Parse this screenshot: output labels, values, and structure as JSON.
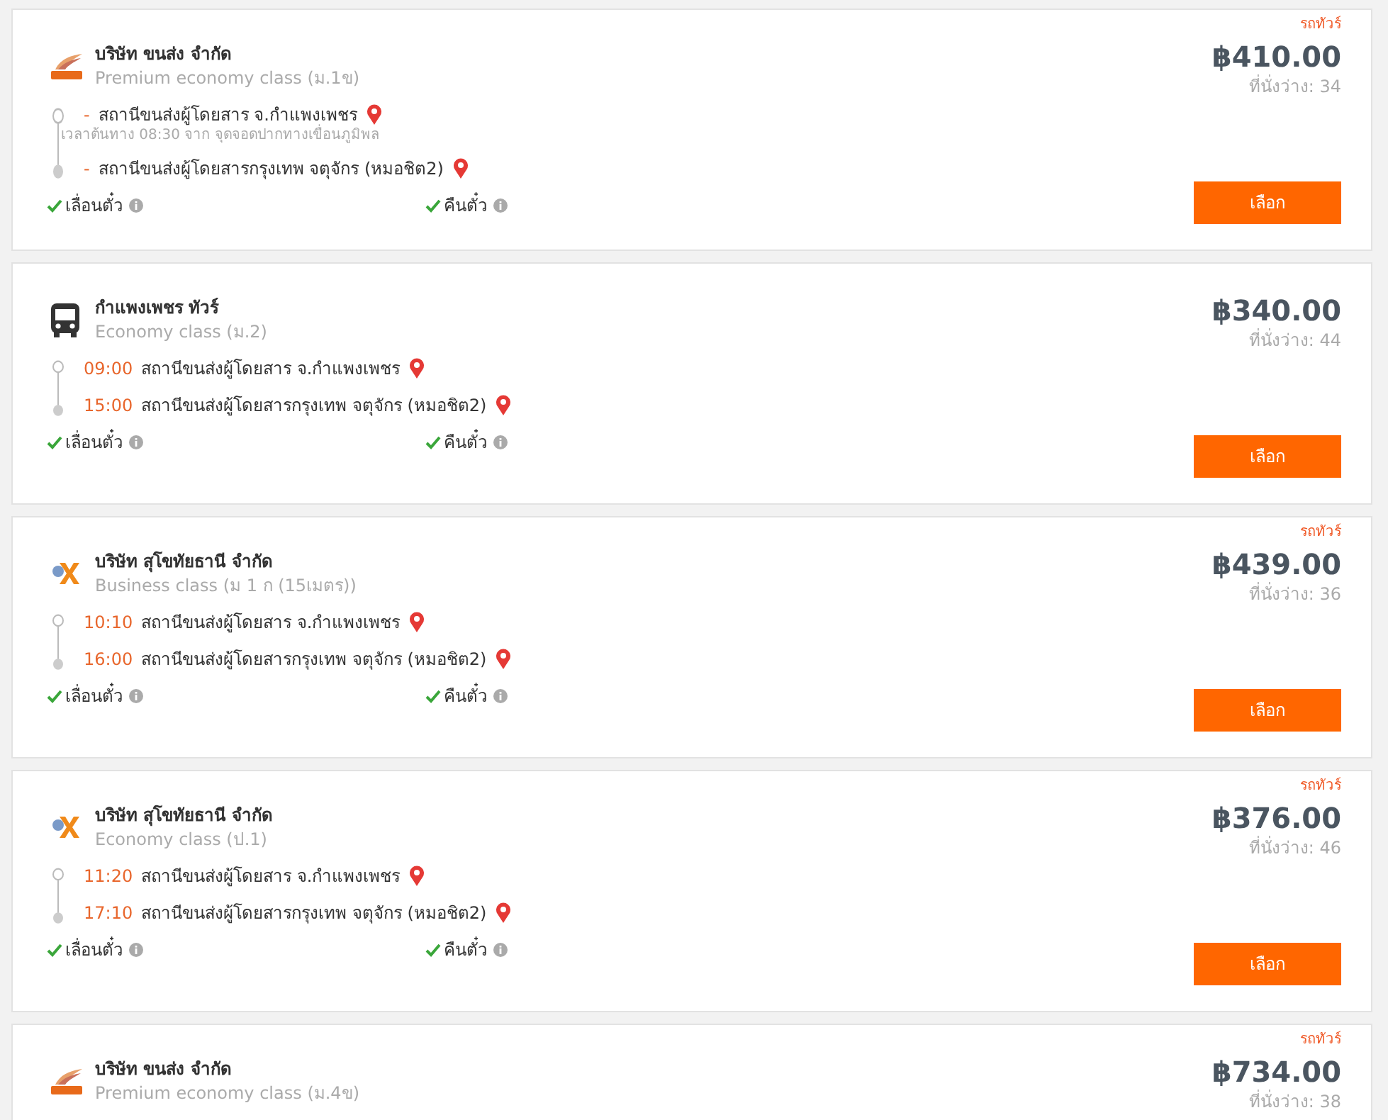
{
  "trips": [
    {
      "logo": {
        "kind": "wing"
      },
      "company": "บริษัท ขนส่ง จำกัด",
      "class": "Premium economy class (ม.1ข)",
      "tour_label": "รถทัวร์",
      "price": "฿410.00",
      "seats": "ที่นั่งว่าง: 34",
      "stops": [
        {
          "time": "-",
          "station": "สถานีขนส่งผู้โดยสาร จ.กำแพงเพชร",
          "note": "เวลาต้นทาง 08:30  จาก จุดจอดปากทางเขื่อนภูมิพล"
        },
        {
          "time": "-",
          "station": "สถานีขนส่งผู้โดยสารกรุงเทพ จตุจักร (หมอชิต2)"
        }
      ],
      "features": [
        {
          "label": "เลื่อนตั๋ว",
          "available": true
        },
        {
          "label": "คืนตั๋ว",
          "available": true
        }
      ],
      "button": "เลือก"
    },
    {
      "logo": {
        "kind": "bus"
      },
      "company": "กำแพงเพชร ทัวร์",
      "class": "Economy class (ม.2)",
      "price": "฿340.00",
      "seats": "ที่นั่งว่าง: 44",
      "stops": [
        {
          "time": "09:00",
          "station": "สถานีขนส่งผู้โดยสาร จ.กำแพงเพชร"
        },
        {
          "time": "15:00",
          "station": "สถานีขนส่งผู้โดยสารกรุงเทพ จตุจักร (หมอชิต2)"
        }
      ],
      "features": [
        {
          "label": "เลื่อนตั๋ว",
          "available": true
        },
        {
          "label": "คืนตั๋ว",
          "available": true
        }
      ],
      "button": "เลือก"
    },
    {
      "logo": {
        "kind": "x"
      },
      "company": "บริษัท สุโขทัยธานี จำกัด",
      "class": "Business class (ม 1 ก (15เมตร))",
      "tour_label": "รถทัวร์",
      "price": "฿439.00",
      "seats": "ที่นั่งว่าง: 36",
      "stops": [
        {
          "time": "10:10",
          "station": "สถานีขนส่งผู้โดยสาร จ.กำแพงเพชร"
        },
        {
          "time": "16:00",
          "station": "สถานีขนส่งผู้โดยสารกรุงเทพ จตุจักร (หมอชิต2)"
        }
      ],
      "features": [
        {
          "label": "เลื่อนตั๋ว",
          "available": true
        },
        {
          "label": "คืนตั๋ว",
          "available": true
        }
      ],
      "button": "เลือก"
    },
    {
      "logo": {
        "kind": "x"
      },
      "company": "บริษัท สุโขทัยธานี จำกัด",
      "class": "Economy class (ป.1)",
      "tour_label": "รถทัวร์",
      "price": "฿376.00",
      "seats": "ที่นั่งว่าง: 46",
      "stops": [
        {
          "time": "11:20",
          "station": "สถานีขนส่งผู้โดยสาร จ.กำแพงเพชร"
        },
        {
          "time": "17:10",
          "station": "สถานีขนส่งผู้โดยสารกรุงเทพ จตุจักร (หมอชิต2)"
        }
      ],
      "features": [
        {
          "label": "เลื่อนตั๋ว",
          "available": true
        },
        {
          "label": "คืนตั๋ว",
          "available": true
        }
      ],
      "button": "เลือก"
    },
    {
      "logo": {
        "kind": "wing"
      },
      "company": "บริษัท ขนส่ง จำกัด",
      "class": "Premium economy class (ม.4ข)",
      "tour_label": "รถทัวร์",
      "price": "฿734.00",
      "seats": "ที่นั่งว่าง: 38"
    }
  ]
}
